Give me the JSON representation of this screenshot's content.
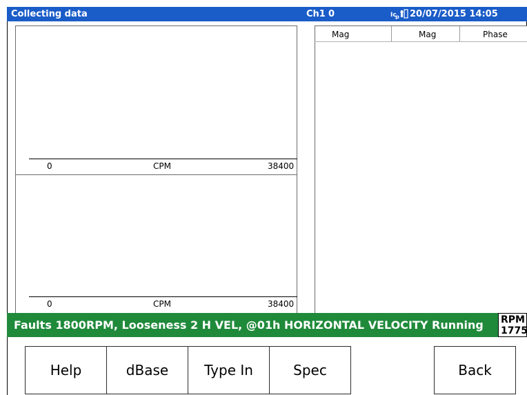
{
  "header": {
    "title": "Collecting data",
    "channel_label": "Ch1",
    "channel_value": "0",
    "icons": [
      "signal-icon",
      "battery-icon"
    ],
    "datetime": "20/07/2015 14:05"
  },
  "plots": [
    {
      "x_min": "0",
      "x_label": "CPM",
      "x_max": "38400"
    },
    {
      "x_min": "0",
      "x_label": "CPM",
      "x_max": "38400"
    }
  ],
  "table": {
    "columns": [
      "Mag",
      "Mag",
      "Phase"
    ],
    "rows": []
  },
  "status": {
    "text": "Faults 1800RPM, Looseness 2 H VEL, @01h HORIZONTAL VELOCITY Running",
    "bg_color": "#1f8a3a"
  },
  "rpm": {
    "label": "RPM",
    "value": "1775"
  },
  "buttons": {
    "help": "Help",
    "dbase": "dBase",
    "type_in": "Type In",
    "spec": "Spec",
    "back": "Back"
  },
  "colors": {
    "header_bg": "#1a5cc8",
    "status_bg": "#1f8a3a"
  }
}
